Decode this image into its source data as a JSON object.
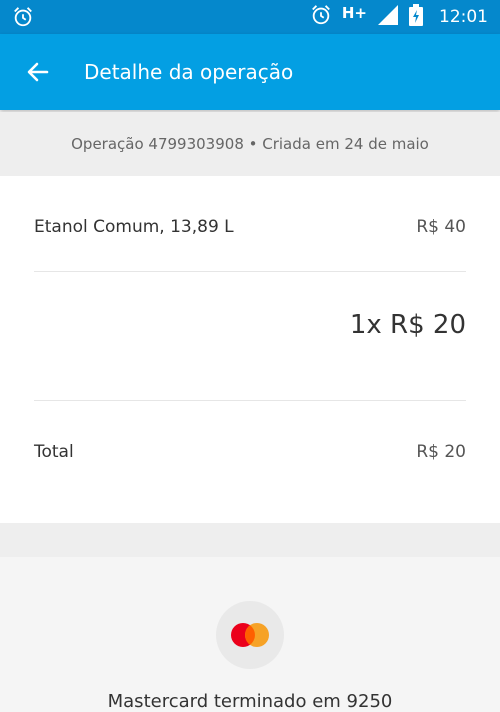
{
  "status_bar": {
    "network": "H+",
    "time": "12:01"
  },
  "app_bar": {
    "title": "Detalhe da operação"
  },
  "operation": {
    "info": "Operação 4799303908 • Criada em 24 de maio"
  },
  "items": [
    {
      "description": "Etanol Comum, 13,89 L",
      "amount": "R$ 40"
    }
  ],
  "installments": "1x R$ 20",
  "total": {
    "label": "Total",
    "amount": "R$ 20"
  },
  "payment": {
    "method_text": "Mastercard terminado em 9250",
    "brand_colors": {
      "left": "#eb001b",
      "right": "#f79e1b"
    }
  },
  "colors": {
    "status_bar": "#0588cc",
    "app_bar": "#039fe3"
  }
}
